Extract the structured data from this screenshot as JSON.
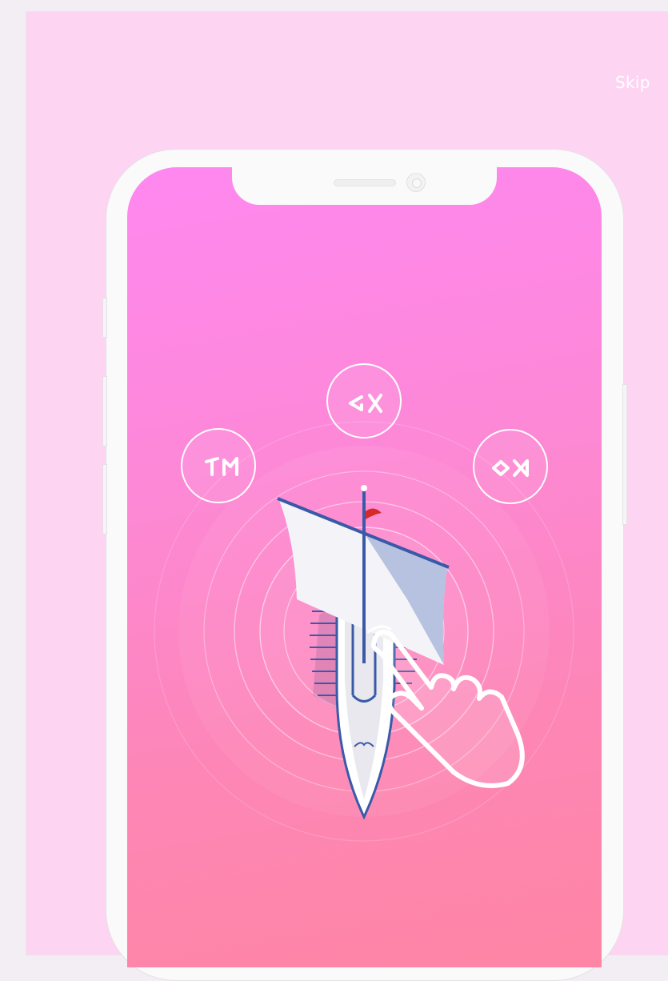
{
  "header": {
    "skip_label": "Skip"
  },
  "options": [
    {
      "id": "left",
      "glyph_icon": "rune-tm-icon"
    },
    {
      "id": "top",
      "glyph_icon": "rune-gx-icon"
    },
    {
      "id": "right",
      "glyph_icon": "rune-ox-icon"
    }
  ],
  "colors": {
    "background": "#fdd4f2",
    "screen_top": "#fe88f0",
    "screen_bottom": "#fe85a4",
    "ship_outline": "#3a5aa8",
    "flag": "#d62a2a"
  },
  "illustration": {
    "subject": "ship-tap-icon"
  }
}
